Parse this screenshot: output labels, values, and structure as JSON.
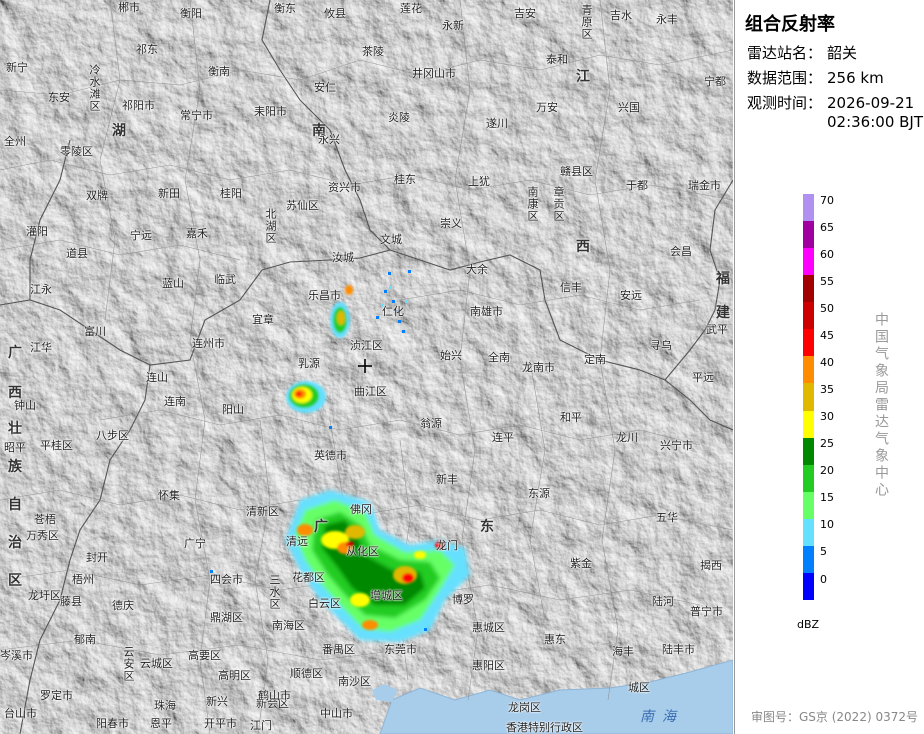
{
  "title": "组合反射率",
  "station": {
    "label": "雷达站名：",
    "value": "韶关"
  },
  "range": {
    "label": "数据范围：",
    "value": "256 km"
  },
  "obs_time": {
    "label": "观测时间：",
    "date": "2026-09-21",
    "time": "02:36:00 BJT"
  },
  "legend": {
    "unit": "dBZ",
    "levels": [
      {
        "label": "0",
        "color": "#0000ff"
      },
      {
        "label": "5",
        "color": "#0080ff"
      },
      {
        "label": "10",
        "color": "#66e0ff"
      },
      {
        "label": "15",
        "color": "#66ff66"
      },
      {
        "label": "20",
        "color": "#22cc22"
      },
      {
        "label": "25",
        "color": "#008800"
      },
      {
        "label": "30",
        "color": "#ffff00"
      },
      {
        "label": "35",
        "color": "#e0b800"
      },
      {
        "label": "40",
        "color": "#ff8c00"
      },
      {
        "label": "45",
        "color": "#ff0000"
      },
      {
        "label": "50",
        "color": "#cc0000"
      },
      {
        "label": "55",
        "color": "#a00000"
      },
      {
        "label": "60",
        "color": "#ff00ff"
      },
      {
        "label": "65",
        "color": "#a000a0"
      },
      {
        "label": "70",
        "color": "#b090f0"
      }
    ]
  },
  "source": "中国气象局雷达气象中心",
  "review_no": "审图号：GS京 (2022) 0372号",
  "provinces": [
    "湖",
    "南",
    "江",
    "西",
    "福",
    "建",
    "广",
    "东",
    "广",
    "西",
    "壮",
    "族",
    "自",
    "治",
    "区"
  ],
  "seas": [
    "南",
    "海"
  ],
  "places": [
    "郴市",
    "衡阳",
    "衡东",
    "攸县",
    "莲花",
    "永新",
    "吉安",
    "吉水",
    "永丰",
    "青原区",
    "新宁",
    "东安",
    "冷水滩区",
    "祁东",
    "衡南",
    "茶陵",
    "井冈山市",
    "泰和",
    "宁都",
    "兴国",
    "零陵区",
    "祁阳市",
    "常宁市",
    "耒阳市",
    "安仁",
    "永兴",
    "炎陵",
    "遂川",
    "万安",
    "双牌",
    "新田",
    "桂阳",
    "苏仙区",
    "资兴市",
    "桂东",
    "上犹",
    "南康区",
    "章贡区",
    "赣县区",
    "于都",
    "瑞金市",
    "道县",
    "宁远",
    "嘉禾",
    "北湖区",
    "汝城",
    "文城",
    "崇义",
    "大余",
    "信丰",
    "会昌",
    "江永",
    "蓝山",
    "临武",
    "宜章",
    "乐昌市",
    "仁化",
    "南雄市",
    "安远",
    "寻乌",
    "武平",
    "江华",
    "连州市",
    "乳源",
    "浈江区",
    "曲江区",
    "始兴",
    "全南",
    "龙南市",
    "定南",
    "平远",
    "富川",
    "连山",
    "连南",
    "阳山",
    "翁源",
    "和平",
    "龙川",
    "兴宁市",
    "钟山",
    "八步区",
    "平桂区",
    "昭平",
    "英德市",
    "连平",
    "新丰",
    "东源",
    "五华",
    "怀集",
    "清新区",
    "佛冈",
    "清远",
    "苍梧",
    "封开",
    "广宁",
    "四会市",
    "三水区",
    "花都区",
    "从化区",
    "龙门",
    "增城区",
    "博罗",
    "惠城区",
    "紫金",
    "陆河",
    "揭西",
    "普宁市",
    "德庆",
    "鼎湖区",
    "白云区",
    "南海区",
    "番禺区",
    "东莞市",
    "惠阳区",
    "惠东",
    "海丰",
    "陆丰市",
    "郁南",
    "云安区",
    "云城区",
    "高要区",
    "高明区",
    "顺德区",
    "南沙区",
    "新会区",
    "江门",
    "岑溪市",
    "罗定市",
    "新兴",
    "鹤山市",
    "开平市",
    "阳春市",
    "中山市",
    "珠海",
    "龙岗区",
    "城区",
    "香港特别行政区",
    "全州",
    "灌阳",
    "恩平",
    "台山市",
    "藤县",
    "万秀区",
    "龙圩区",
    "梧州"
  ]
}
